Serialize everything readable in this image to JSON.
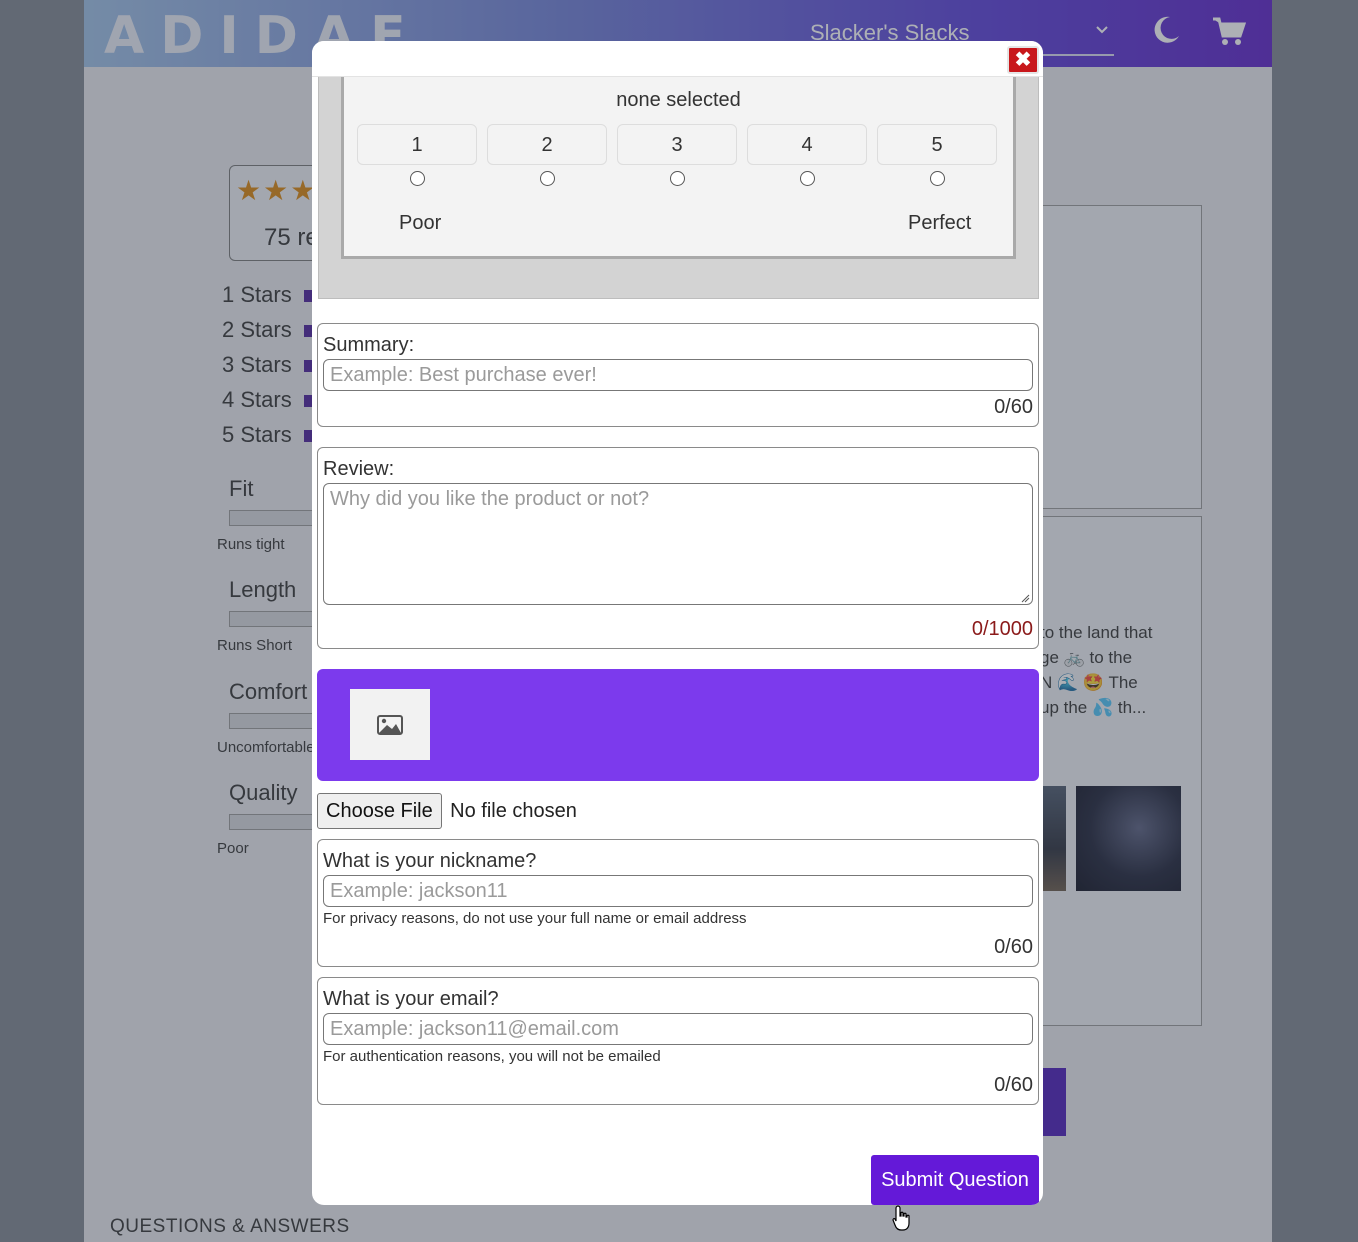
{
  "header": {
    "logo_text": "ADIDAE",
    "product_select": "Slacker's Slacks",
    "icons": [
      "moon-icon",
      "cart-icon",
      "chevron-down-icon"
    ]
  },
  "ratings_summary": {
    "stars": "★★★",
    "reviews_text": "75 re",
    "breakdown": [
      "1 Stars",
      "2 Stars",
      "3 Stars",
      "4 Stars",
      "5 Stars"
    ]
  },
  "factors": [
    {
      "name": "Fit",
      "note": "Runs tight"
    },
    {
      "name": "Length",
      "note": "Runs Short"
    },
    {
      "name": "Comfort",
      "note": "Uncomfortable"
    },
    {
      "name": "Quality",
      "note": "Poor"
    }
  ],
  "review_snippet": {
    "lines": [
      "to the land that",
      "ge 🚲 to the",
      "N 🌊 🤩 The",
      "up the 💦 th..."
    ]
  },
  "qa_heading": "QUESTIONS & ANSWERS",
  "modal": {
    "close_label": "✖",
    "rating": {
      "status": "none selected",
      "options": [
        "1",
        "2",
        "3",
        "4",
        "5"
      ],
      "low_label": "Poor",
      "high_label": "Perfect"
    },
    "summary": {
      "label": "Summary:",
      "placeholder": "Example: Best purchase ever!",
      "counter": "0/60"
    },
    "review": {
      "label": "Review:",
      "placeholder": "Why did you like the product or not?",
      "counter": "0/1000"
    },
    "upload": {
      "choose_label": "Choose File",
      "status": "No file chosen",
      "icon": "image-icon"
    },
    "nickname": {
      "label": "What is your nickname?",
      "placeholder": "Example: jackson11",
      "hint": "For privacy reasons, do not use your full name or email address",
      "counter": "0/60"
    },
    "email": {
      "label": "What is your email?",
      "placeholder": "Example: jackson11@email.com",
      "hint": "For authentication reasons, you will not be emailed",
      "counter": "0/60"
    },
    "submit_label": "Submit Question"
  },
  "colors": {
    "accent": "#7c3aed",
    "submit": "#6419d8",
    "close": "#c8171b",
    "star": "#d9860d"
  }
}
